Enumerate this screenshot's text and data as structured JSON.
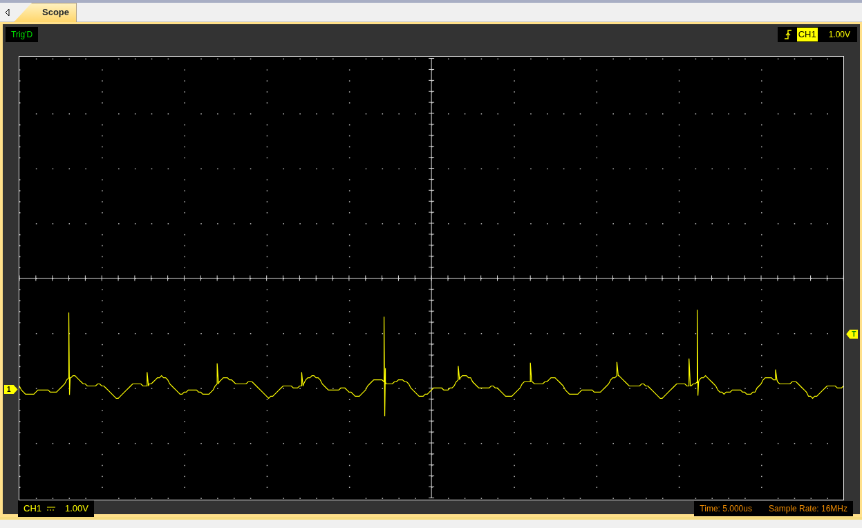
{
  "tabs": [
    {
      "label": "Scope",
      "selected": true
    }
  ],
  "trigger_status": "Trig'D",
  "trigger": {
    "source": "CH1",
    "level": "1.00V"
  },
  "channel_info": {
    "name": "CH1",
    "scale": "1.00V"
  },
  "timebase": "Time: 5.000us",
  "sample_rate": "Sample Rate: 16MHz",
  "markers": {
    "channel": "1",
    "trigger": "T"
  }
}
